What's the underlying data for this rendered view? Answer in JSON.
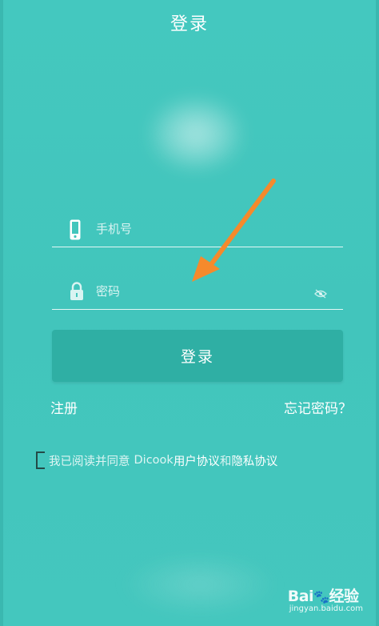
{
  "header": {
    "title": "登录"
  },
  "form": {
    "phone_placeholder": "手机号",
    "password_placeholder": "密码",
    "login_label": "登录"
  },
  "links": {
    "register": "注册",
    "forgot_password": "忘记密码？"
  },
  "agreement": {
    "prefix": "我已阅读并同意",
    "app_name": "Dicook",
    "user_agreement": "用户协议",
    "and": "和",
    "privacy_policy": "隐私协议"
  },
  "watermark": {
    "brand_a": "Bai",
    "brand_b": "经验",
    "url": "jingyan.baidu.com"
  },
  "colors": {
    "background": "#43c6bd",
    "button": "#2fafa4",
    "annotation_arrow": "#f58a2c"
  },
  "icons": [
    "phone-icon",
    "lock-icon",
    "eye-hidden-icon",
    "checkbox",
    "arrow-annotation"
  ]
}
